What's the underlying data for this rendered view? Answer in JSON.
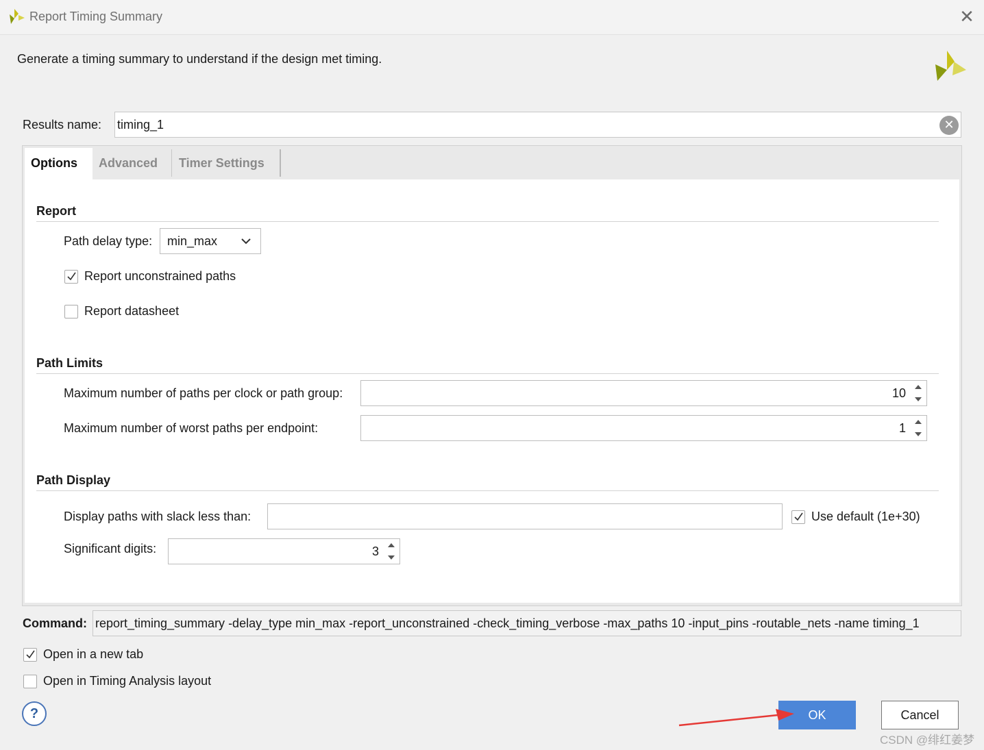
{
  "window": {
    "title": "Report Timing Summary"
  },
  "description": "Generate a timing summary to understand if the design met timing.",
  "results": {
    "label": "Results name:",
    "value": "timing_1"
  },
  "tabs": [
    {
      "label": "Options",
      "active": true
    },
    {
      "label": "Advanced",
      "active": false
    },
    {
      "label": "Timer Settings",
      "active": false
    }
  ],
  "report": {
    "heading": "Report",
    "path_delay_label": "Path delay type:",
    "path_delay_value": "min_max",
    "unconstrained_label": "Report unconstrained paths",
    "unconstrained_checked": true,
    "datasheet_label": "Report datasheet",
    "datasheet_checked": false
  },
  "path_limits": {
    "heading": "Path Limits",
    "max_paths_label": "Maximum number of paths per clock or path group:",
    "max_paths_value": "10",
    "worst_paths_label": "Maximum number of worst paths per endpoint:",
    "worst_paths_value": "1"
  },
  "path_display": {
    "heading": "Path Display",
    "slack_label": "Display paths with slack less than:",
    "slack_value": "",
    "use_default_label": "Use default (1e+30)",
    "use_default_checked": true,
    "sig_digits_label": "Significant digits:",
    "sig_digits_value": "3"
  },
  "command": {
    "label": "Command:",
    "text": "report_timing_summary -delay_type min_max -report_unconstrained -check_timing_verbose -max_paths 10 -input_pins -routable_nets -name timing_1"
  },
  "open_new_tab": {
    "label": "Open in a new tab",
    "checked": true
  },
  "open_timing_layout": {
    "label": "Open in Timing Analysis layout",
    "checked": false
  },
  "buttons": {
    "help": "?",
    "ok": "OK",
    "cancel": "Cancel"
  },
  "watermark": "CSDN @绯红姜梦",
  "colors": {
    "ok_button": "#4c86d8",
    "logo_yellow": "#c9c21a",
    "logo_green": "#8a9a10",
    "annotation_arrow": "#e53935"
  }
}
